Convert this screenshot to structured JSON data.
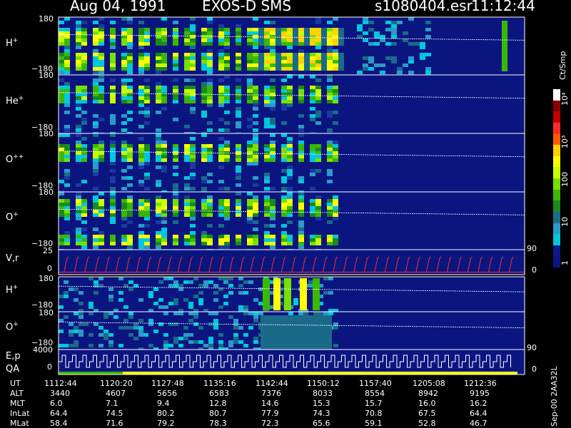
{
  "header": {
    "date": "Aug 04, 1991",
    "instrument": "EXOS-D SMS",
    "file": "s1080404.esr",
    "time": "11:12:44"
  },
  "colorbar": {
    "unit_label": "Ct/Smp",
    "tick_labels": [
      "10⁴",
      "10³",
      "100",
      "10",
      "1"
    ],
    "colors": [
      "#ffffff",
      "#8b0000",
      "#c00000",
      "#ff2a2a",
      "#ff5a00",
      "#ffd200",
      "#ffff00",
      "#c8ff00",
      "#78e000",
      "#3ab800",
      "#1a8a1a",
      "#1a6a8a",
      "#2a9ac8",
      "#00c8dc",
      "#0a1a88",
      "#0b1580"
    ]
  },
  "panels": [
    {
      "id": "h-plus",
      "label": "H",
      "sup": "+",
      "top_tick": "180",
      "bottom_tick": "−180"
    },
    {
      "id": "he-plus",
      "label": "He",
      "sup": "+",
      "top_tick": "180",
      "bottom_tick": "−180"
    },
    {
      "id": "o-plus-plus",
      "label": "O",
      "sup": "++",
      "top_tick": "180",
      "bottom_tick": "−180"
    },
    {
      "id": "o-plus",
      "label": "O",
      "sup": "+",
      "top_tick": "180",
      "bottom_tick": "−180"
    },
    {
      "id": "vr",
      "label": "V,r",
      "top_tick": "25",
      "bottom_tick": "0",
      "right_top_tick": "90",
      "right_bottom_tick": "0"
    },
    {
      "id": "h-plus-2",
      "label": "H",
      "sup": "+",
      "top_tick": "180",
      "bottom_tick": "−180"
    },
    {
      "id": "o-plus-2",
      "label": "O",
      "sup": "+",
      "top_tick": "180",
      "bottom_tick": "−180",
      "right_bottom_tick": "90"
    },
    {
      "id": "ep-qa",
      "label": "E,p",
      "label2": "QA",
      "top_tick": "4000",
      "bottom_tick": "0",
      "right_bottom_tick": "0"
    }
  ],
  "footer": {
    "rows": [
      {
        "name": "UT",
        "values": [
          "1112:44",
          "1120:20",
          "1127:48",
          "1135:16",
          "1142:44",
          "1150:12",
          "1157:40",
          "1205:08",
          "1212:36"
        ]
      },
      {
        "name": "ALT",
        "values": [
          "3440",
          "4607",
          "5656",
          "6583",
          "7376",
          "8033",
          "8554",
          "8942",
          "9195"
        ]
      },
      {
        "name": "MLT",
        "values": [
          "6.0",
          "7.1",
          "9.4",
          "12.8",
          "14.6",
          "15.3",
          "15.7",
          "16.0",
          "16.2"
        ]
      },
      {
        "name": "InLat",
        "values": [
          "64.4",
          "74.5",
          "80.2",
          "80.7",
          "77.9",
          "74.3",
          "70.8",
          "67.5",
          "64.4"
        ]
      },
      {
        "name": "MLat",
        "values": [
          "58.4",
          "71.6",
          "79.2",
          "78.3",
          "72.3",
          "65.6",
          "59.1",
          "52.8",
          "46.7"
        ]
      }
    ]
  },
  "sidebar_text": "Sep-00  2AA32L",
  "chart_data": {
    "type": "heatmap",
    "title": "Aug 04, 1991   EXOS-D SMS",
    "x_tick_labels": [
      "1112:44",
      "1120:20",
      "1127:48",
      "1135:16",
      "1142:44",
      "1150:12",
      "1157:40",
      "1205:08",
      "1212:36"
    ],
    "panels": [
      "H+",
      "He+",
      "O++",
      "O+",
      "V,r",
      "H+",
      "O+",
      "E,p QA"
    ],
    "y_range_pitch": [
      -180,
      180
    ],
    "colorbar_range": [
      1,
      10000
    ],
    "colorbar_scale": "log",
    "colorbar_unit": "Ct/Smp"
  }
}
